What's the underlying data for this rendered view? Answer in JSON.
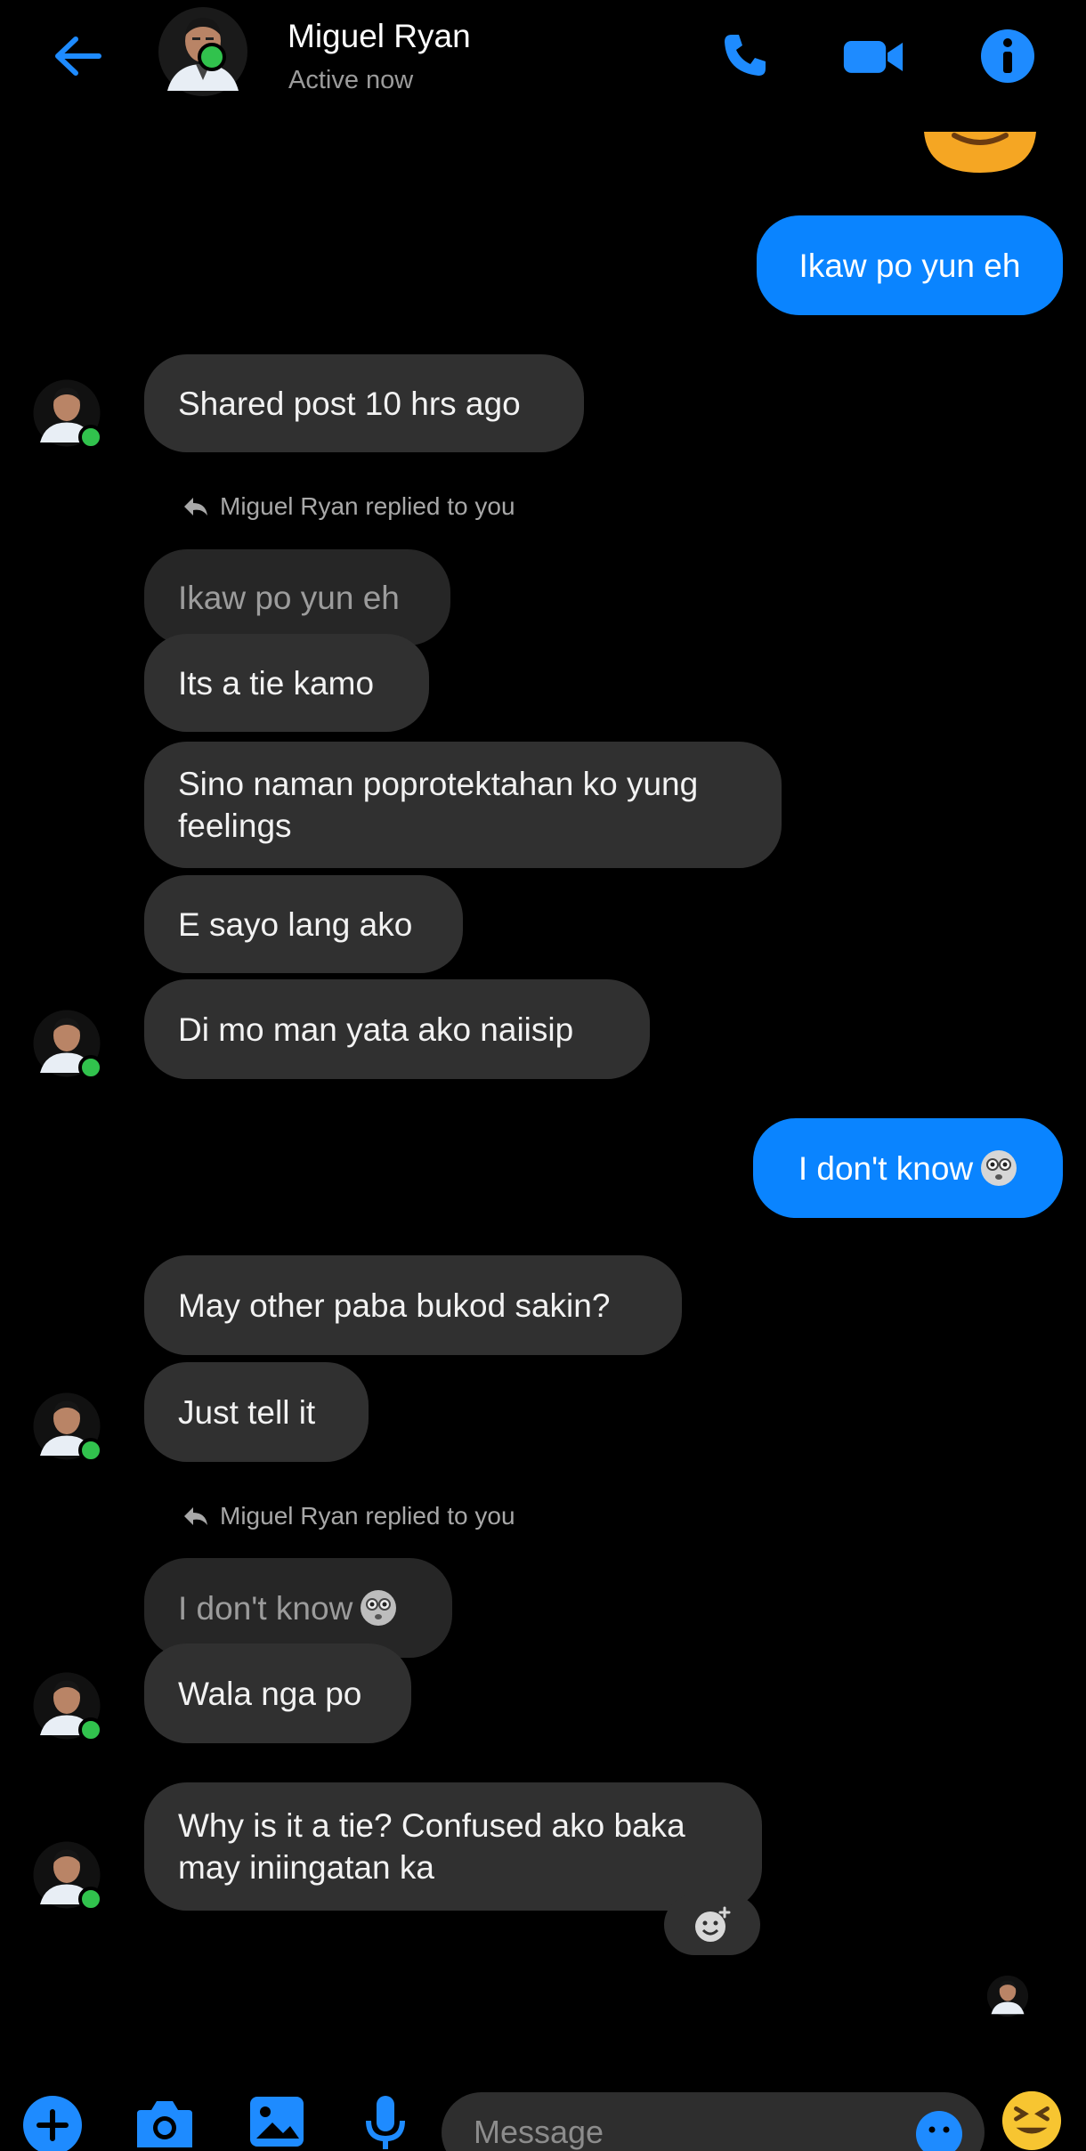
{
  "header": {
    "contact_name": "Miguel Ryan",
    "status": "Active now",
    "back_icon": "arrow-left-icon",
    "call_icon": "phone-icon",
    "video_icon": "video-camera-icon",
    "info_icon": "info-icon"
  },
  "colors": {
    "accent": "#0a84ff",
    "incoming_bubble": "#303030",
    "online": "#31c24d",
    "background": "#000000"
  },
  "messages": {
    "m1": "Ikaw po yun eh",
    "m2": "Shared post 10 hrs ago",
    "reply1_label": "Miguel Ryan replied to you",
    "reply1_quote": "Ikaw po yun eh",
    "m3": "Its a tie kamo",
    "m4": "Sino naman poprotektahan ko yung feelings",
    "m5": "E sayo lang ako",
    "m6": "Di mo man yata ako naiisip",
    "m7": "I don't know",
    "m8": "May other paba bukod sakin?",
    "m9": "Just tell it",
    "reply2_label": "Miguel Ryan replied to you",
    "reply2_quote": "I don't know",
    "m10": "Wala nga po",
    "m11": "Why is it a tie? Confused ako baka may iniingatan ka"
  },
  "composer": {
    "placeholder": "Message",
    "icons": [
      "plus-icon",
      "camera-icon",
      "gallery-icon",
      "microphone-icon",
      "emoji-icon",
      "laughing-emoji-icon"
    ]
  }
}
